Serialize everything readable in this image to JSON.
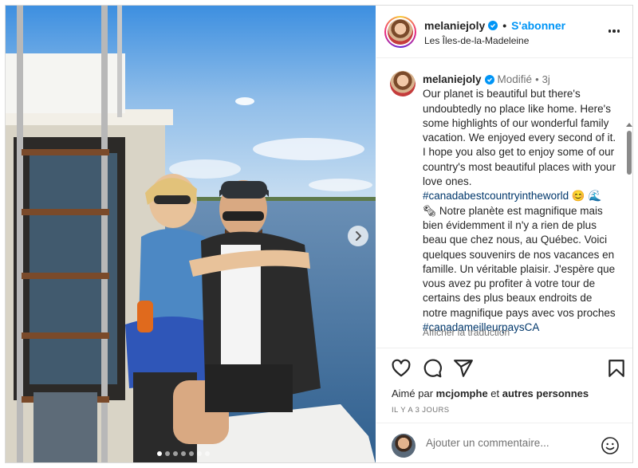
{
  "post": {
    "username": "melaniejoly",
    "follow_label": "S'abonner",
    "location": "Les Îles-de-la-Madeleine",
    "carousel_dots": 7,
    "carousel_active": 0
  },
  "caption": {
    "username": "melaniejoly",
    "edited_label": "Modifié",
    "separator": "•",
    "time": "3j",
    "text_en": "Our planet is beautiful but there's undoubtedly no place like home. Here's some highlights of our wonderful family vacation. We enjoyed every second of it. I hope you also get to enjoy some of our country's most beautiful places with your love ones.",
    "hashtag_en": "#canadabestcountryintheworld",
    "emoji_en": "😊 🌊",
    "emoji_fr": "🗞",
    "text_fr": "Notre planète est magnifique mais bien évidemment il n'y a rien de plus beau que chez nous, au Québec. Voici quelques souvenirs de nos vacances en famille. Un véritable plaisir. J'espère que vous avez pu profiter à votre tour de certains des plus beaux endroits de notre magnifique pays avec vos proches",
    "hashtag_fr": "#canadameilleurpaysCA",
    "translate_label": "Afficher la traduction"
  },
  "likes": {
    "prefix": "Aimé par",
    "user": "mcjomphe",
    "connector": "et",
    "others": "autres personnes"
  },
  "timestamp": "IL Y A 3 JOURS",
  "comment_box": {
    "placeholder": "Ajouter un commentaire..."
  },
  "colors": {
    "link": "#0095f6",
    "hashtag": "#00376b",
    "muted": "#737373",
    "text": "#262626"
  }
}
